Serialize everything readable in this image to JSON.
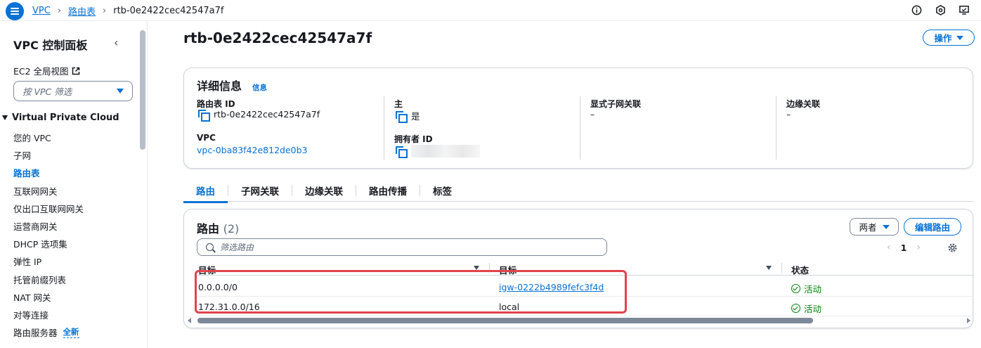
{
  "breadcrumb": {
    "items": [
      "VPC",
      "路由表"
    ],
    "current": "rtb-0e2422cec42547a7f"
  },
  "sidebar": {
    "title": "VPC 控制面板",
    "ec2_link": "EC2 全局视图",
    "filter_placeholder": "按 VPC 筛选",
    "section": "Virtual Private Cloud",
    "items": [
      {
        "label": "您的 VPC"
      },
      {
        "label": "子网"
      },
      {
        "label": "路由表",
        "active": true
      },
      {
        "label": "互联网网关"
      },
      {
        "label": "仅出口互联网网关"
      },
      {
        "label": "运营商网关"
      },
      {
        "label": "DHCP 选项集"
      },
      {
        "label": "弹性 IP"
      },
      {
        "label": "托管前缀列表"
      },
      {
        "label": "NAT 网关"
      },
      {
        "label": "对等连接"
      },
      {
        "label": "路由服务器",
        "badge": "全新"
      }
    ]
  },
  "page": {
    "title": "rtb-0e2422cec42547a7f",
    "actions_label": "操作"
  },
  "details": {
    "heading": "详细信息",
    "info": "信息",
    "route_table_id_label": "路由表 ID",
    "route_table_id": "rtb-0e2422cec42547a7f",
    "vpc_label": "VPC",
    "vpc_value": "vpc-0ba83f42e812de0b3",
    "main_label": "主",
    "main_value": "是",
    "owner_label": "拥有者 ID",
    "explicit_label": "显式子网关联",
    "explicit_value": "–",
    "edge_label": "边缘关联",
    "edge_value": "–"
  },
  "tabs": [
    "路由",
    "子网关联",
    "边缘关联",
    "路由传播",
    "标签"
  ],
  "routes": {
    "heading": "路由",
    "count": "(2)",
    "both_label": "两者",
    "edit_label": "编辑路由",
    "filter_placeholder": "筛选路由",
    "page": "1",
    "columns": [
      "目标",
      "目标",
      "状态"
    ],
    "rows": [
      {
        "destination": "0.0.0.0/0",
        "target": "igw-0222b4989fefc3f4d",
        "status": "活动"
      },
      {
        "destination": "172.31.0.0/16",
        "target": "local",
        "status": "活动"
      }
    ]
  },
  "colors": {
    "accent": "#0972d3",
    "success": "#037f0c",
    "highlight": "#e0434a"
  }
}
